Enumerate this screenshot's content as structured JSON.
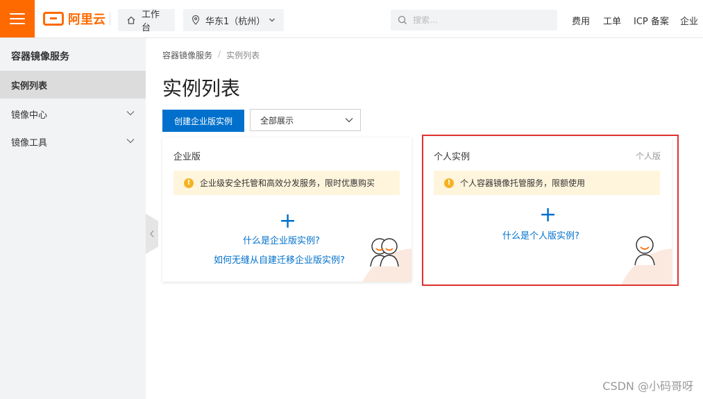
{
  "header": {
    "logo_text": "阿里云",
    "workbench_label": "工作台",
    "region_label": "华东1（杭州）",
    "search_placeholder": "搜索...",
    "nav": [
      "费用",
      "工单",
      "ICP 备案",
      "企业"
    ]
  },
  "sidebar": {
    "title": "容器镜像服务",
    "items": [
      {
        "label": "实例列表"
      },
      {
        "label": "镜像中心"
      },
      {
        "label": "镜像工具"
      }
    ]
  },
  "breadcrumb": {
    "parent": "容器镜像服务",
    "separator": "/",
    "current": "实例列表"
  },
  "page": {
    "title": "实例列表",
    "create_button": "创建企业版实例",
    "filter_select": "全部展示"
  },
  "cards": {
    "enterprise": {
      "title": "企业版",
      "notice": "企业级安全托管和高效分发服务，限时优惠购买",
      "plus": "+",
      "link1": "什么是企业版实例?",
      "link2": "如何无缝从自建迁移企业版实例?"
    },
    "personal": {
      "title": "个人实例",
      "tag": "个人版",
      "notice": "个人容器镜像托管服务，限额使用",
      "plus": "+",
      "link1": "什么是个人版实例?"
    }
  },
  "watermark": "CSDN @小码哥呀",
  "colors": {
    "brand": "#ff6a00",
    "primary": "#0070cc",
    "highlight": "#e03030",
    "notice_bg": "#fff5dc"
  }
}
